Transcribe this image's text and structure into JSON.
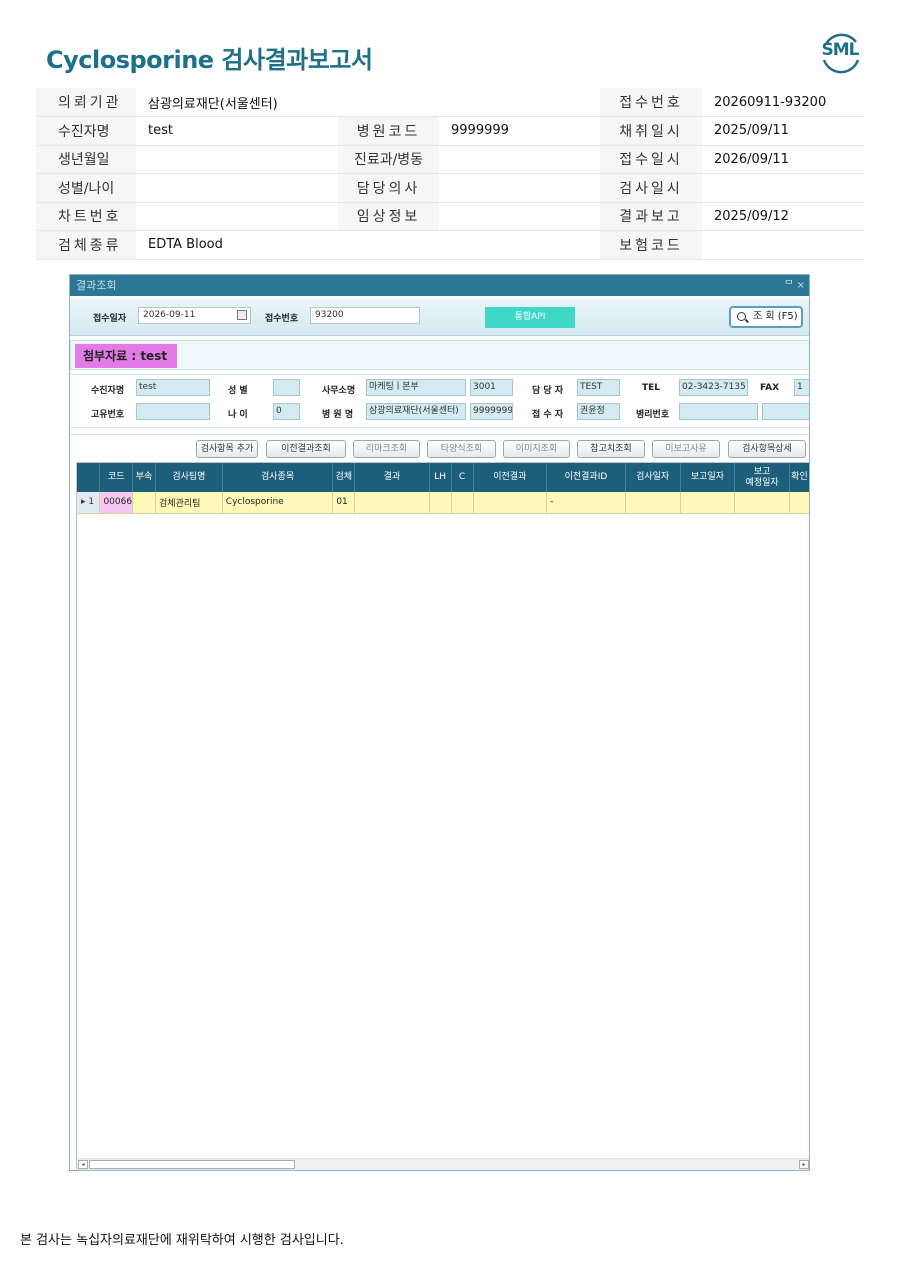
{
  "report": {
    "title": "Cyclosporine 검사결과보고서",
    "logo_text": "SML",
    "footer": "본 검사는 녹십자의료재단에 재위탁하여 시행한 검사입니다."
  },
  "info": {
    "labels": {
      "institution": "의뢰기관",
      "reception_no": "접수번호",
      "patient_name": "수진자명",
      "hospital_code": "병원코드",
      "collected_date": "채취일시",
      "birth": "생년월일",
      "dept": "진료과/병동",
      "received_date": "접수일시",
      "sex_age": "성별/나이",
      "doctor": "담당의사",
      "test_date": "검사일시",
      "chart_no": "차트번호",
      "clinical": "임상정보",
      "report_date": "결과보고",
      "specimen": "검체종류",
      "insurance": "보험코드"
    },
    "values": {
      "institution": "삼광의료재단(서울센터)",
      "reception_no": "20260911-93200",
      "patient_name": "test",
      "hospital_code": "9999999",
      "collected_date": "2025/09/11",
      "birth": "",
      "dept": "",
      "received_date": "2026/09/11",
      "sex_age": "",
      "doctor": "",
      "test_date": "",
      "chart_no": "",
      "clinical": "",
      "report_date": "2025/09/12",
      "specimen": "EDTA Blood",
      "insurance": ""
    }
  },
  "app": {
    "window_title": "결과조회",
    "window_buttons": "ᄆ  ×",
    "search": {
      "date_label": "접수일자",
      "date_value": "2026-09-11",
      "no_label": "접수번호",
      "no_value": "93200",
      "api_button": "통합API",
      "search_button": "조  회 (F5)"
    },
    "attachment": "첨부자료 : test",
    "patient": {
      "name_label": "수진자명",
      "name_value": "test",
      "sex_label": "성    별",
      "sex_value": "",
      "office_label": "사무소명",
      "office_value": "마케팅ㅣ본부",
      "office_code": "3001",
      "manager_label": "담 당 자",
      "manager_value": "TEST",
      "tel_label": "TEL",
      "tel_value": "02-3423-7135",
      "fax_label": "FAX",
      "fax_value": "1",
      "id_label": "고유번호",
      "id_value": "",
      "age_label": "나    이",
      "age_value": "0",
      "hospital_label": "병 원 명",
      "hospital_value": "삼광의료재단(서울센터)",
      "hospital_code": "9999999",
      "receiver_label": "접 수 자",
      "receiver_value": "권윤정",
      "pathology_label": "병리번호",
      "pathology_value": ""
    },
    "buttons": [
      "검사항목 추가",
      "이전결과조회",
      "리마크조회",
      "타양식조회",
      "이미지조회",
      "참고치조회",
      "미보고사유",
      "검사항목상세"
    ],
    "grid": {
      "headers": [
        "",
        "코드",
        "부속",
        "검사팀명",
        "검사종목",
        "검체",
        "결과",
        "LH",
        "C",
        "이전결과",
        "이전결과ID",
        "검사일자",
        "보고일자",
        "보고\n예정일자",
        "확인"
      ],
      "rows": [
        {
          "indicator": "▸ 1",
          "code": "00066",
          "sub": "",
          "team": "검체관리팀",
          "test": "Cyclosporine",
          "specimen": "01",
          "result": "",
          "lh": "",
          "c": "",
          "prev_result": "",
          "prev_id": "-",
          "test_date": "",
          "report_date": "",
          "expected_date": "",
          "confirm": ""
        }
      ]
    }
  },
  "colors": {
    "title": "#1e6f8a",
    "window_header": "#2a7796",
    "grid_header": "#1d5f7a",
    "row_highlight": "#fff9b8",
    "code_cell": "#f6c7f3",
    "attachment": "#e37be6",
    "api_button": "#3fd8c6"
  }
}
